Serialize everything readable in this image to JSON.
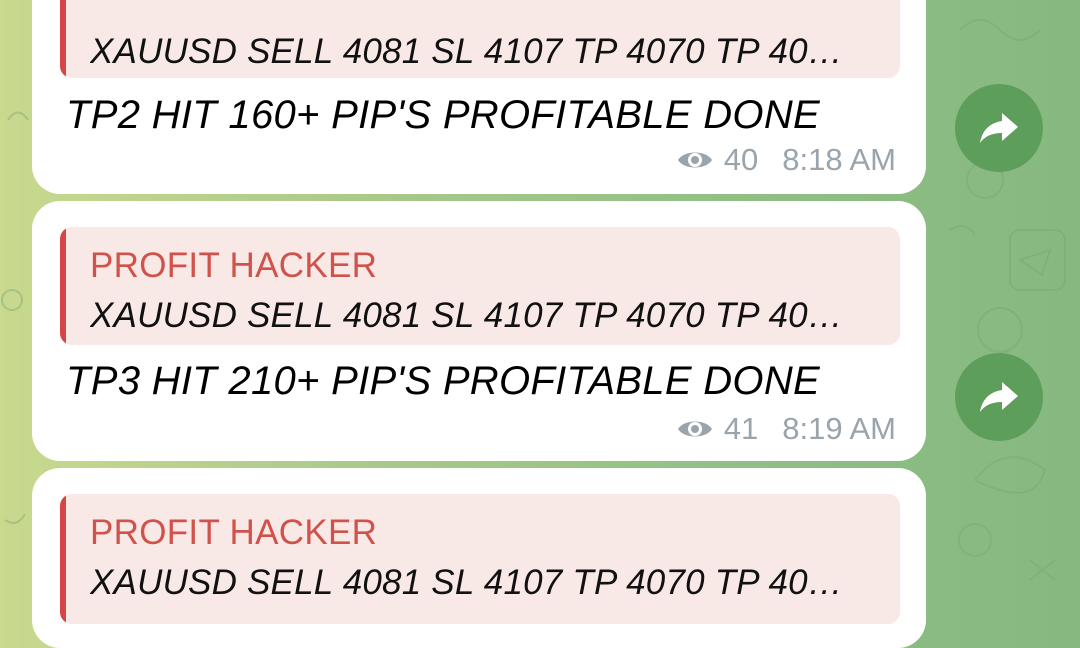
{
  "messages": [
    {
      "quote_author": "",
      "quote_text": "XAUUSD SELL 4081 SL 4107 TP 4070 TP 40…",
      "text": "TP2 HIT 160+ PIP'S PROFITABLE DONE",
      "views": "40",
      "time": "8:18 AM"
    },
    {
      "quote_author": "PROFIT HACKER",
      "quote_text": "XAUUSD SELL 4081 SL 4107 TP 4070 TP 40…",
      "text": "TP3 HIT 210+ PIP'S PROFITABLE DONE",
      "views": "41",
      "time": "8:19 AM"
    },
    {
      "quote_author": "PROFIT HACKER",
      "quote_text": "XAUUSD SELL 4081 SL 4107 TP 4070 TP 40…"
    }
  ],
  "colors": {
    "quote_accent": "#d64545",
    "quote_author": "#d1524b",
    "share_button": "#5e9e5b",
    "meta_text": "#9aa4ad"
  },
  "icons": {
    "views": "eye-icon",
    "share": "share-arrow-icon"
  }
}
